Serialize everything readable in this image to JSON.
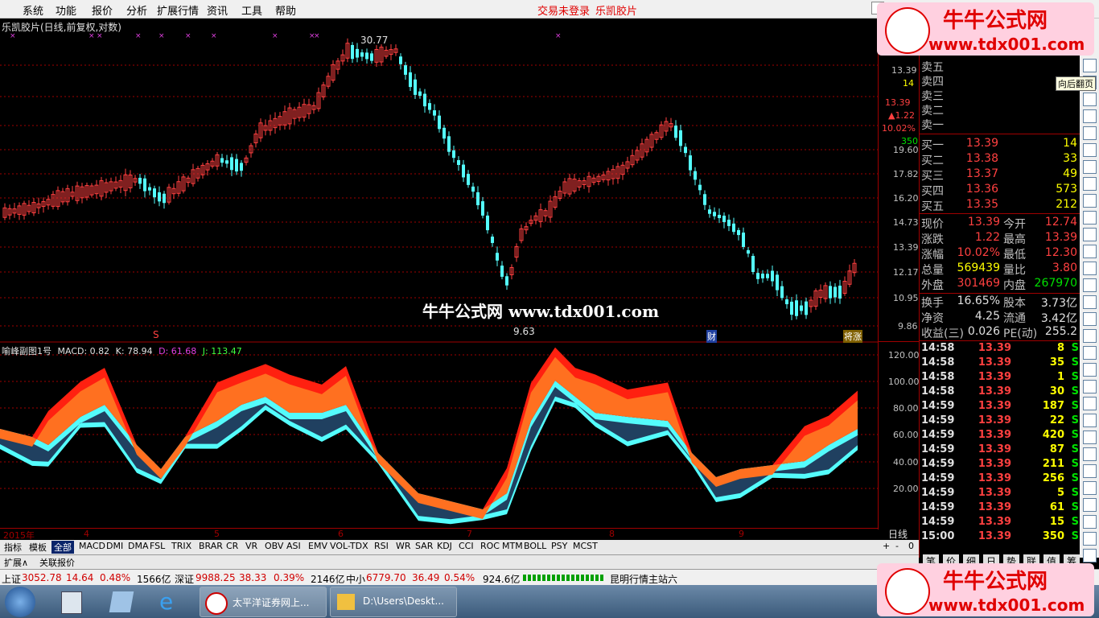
{
  "menu": {
    "items": [
      "系统",
      "功能",
      "报价",
      "分析",
      "扩展行情",
      "资讯",
      "工具",
      "帮助"
    ],
    "status": "交易未登录",
    "stock": "乐凯胶片"
  },
  "chart": {
    "title": "乐凯胶片(日线,前复权,对数)",
    "high_label": "30.77",
    "low_label": "9.63",
    "watermark": "牛牛公式网 www.tdx001.com",
    "marker_cai": "财",
    "marker_jiezhang": "将涨",
    "marker_s": "S",
    "price_ticks": [
      "13.39",
      "13.39",
      "12.17",
      "10.95",
      "9.86",
      "14.73",
      "16.20",
      "17.82",
      "19.60"
    ],
    "price_header": [
      "13.39",
      "14",
      "13.39",
      "▲1.22",
      "10.02%",
      "350"
    ],
    "indicator_title": "喻峰副图1号",
    "macd": "MACD: 0.82",
    "k": "K: 78.94",
    "d": "D: 61.68",
    "j": "J: 113.47",
    "ind_ticks": [
      "120.00",
      "100.00",
      "80.00",
      "60.00",
      "40.00",
      "20.00"
    ],
    "dates": [
      "2015年",
      "4",
      "5",
      "6",
      "7",
      "8",
      "9"
    ],
    "period": "日线"
  },
  "tabs": [
    "指标",
    "模板",
    "全部",
    "MACD",
    "DMI",
    "DMA",
    "FSL",
    "TRIX",
    "BRAR",
    "CR",
    "VR",
    "OBV",
    "ASI",
    "EMV",
    "VOL-TDX",
    "RSI",
    "WR",
    "SAR",
    "KDJ",
    "CCI",
    "ROC",
    "MTM",
    "BOLL",
    "PSY",
    "MCST"
  ],
  "tabs2": [
    "扩展∧",
    "关联报价"
  ],
  "tab_controls": [
    "+",
    "-",
    "0"
  ],
  "quote": {
    "sell": [
      "卖五",
      "卖四",
      "卖三",
      "卖二",
      "卖一"
    ],
    "buy": [
      {
        "label": "买一",
        "price": "13.39",
        "vol": "14"
      },
      {
        "label": "买二",
        "price": "13.38",
        "vol": "33"
      },
      {
        "label": "买三",
        "price": "13.37",
        "vol": "49"
      },
      {
        "label": "买四",
        "price": "13.36",
        "vol": "573"
      },
      {
        "label": "买五",
        "price": "13.35",
        "vol": "212"
      }
    ],
    "stats": [
      {
        "l1": "现价",
        "v1": "13.39",
        "l2": "今开",
        "v2": "12.74"
      },
      {
        "l1": "涨跌",
        "v1": "1.22",
        "l2": "最高",
        "v2": "13.39"
      },
      {
        "l1": "涨幅",
        "v1": "10.02%",
        "l2": "最低",
        "v2": "12.30"
      },
      {
        "l1": "总量",
        "v1": "569439",
        "l2": "量比",
        "v2": "3.80"
      },
      {
        "l1": "外盘",
        "v1": "301469",
        "l2": "内盘",
        "v2": "267970"
      }
    ],
    "stats2": [
      {
        "l1": "换手",
        "v1": "16.65%",
        "l2": "股本",
        "v2": "3.73亿"
      },
      {
        "l1": "净资",
        "v1": "4.25",
        "l2": "流通",
        "v2": "3.42亿"
      },
      {
        "l1": "收益(三)",
        "v1": "0.026",
        "l2": "PE(动)",
        "v2": "255.2"
      }
    ],
    "ticks": [
      {
        "t": "14:58",
        "p": "13.39",
        "v": "8",
        "s": "S"
      },
      {
        "t": "14:58",
        "p": "13.39",
        "v": "35",
        "s": "S"
      },
      {
        "t": "14:58",
        "p": "13.39",
        "v": "1",
        "s": "S"
      },
      {
        "t": "14:58",
        "p": "13.39",
        "v": "30",
        "s": "S"
      },
      {
        "t": "14:59",
        "p": "13.39",
        "v": "187",
        "s": "S"
      },
      {
        "t": "14:59",
        "p": "13.39",
        "v": "22",
        "s": "S"
      },
      {
        "t": "14:59",
        "p": "13.39",
        "v": "420",
        "s": "S"
      },
      {
        "t": "14:59",
        "p": "13.39",
        "v": "87",
        "s": "S"
      },
      {
        "t": "14:59",
        "p": "13.39",
        "v": "211",
        "s": "S"
      },
      {
        "t": "14:59",
        "p": "13.39",
        "v": "256",
        "s": "S"
      },
      {
        "t": "14:59",
        "p": "13.39",
        "v": "5",
        "s": "S"
      },
      {
        "t": "14:59",
        "p": "13.39",
        "v": "61",
        "s": "S"
      },
      {
        "t": "14:59",
        "p": "13.39",
        "v": "15",
        "s": "S"
      },
      {
        "t": "15:00",
        "p": "13.39",
        "v": "350",
        "s": "S"
      }
    ],
    "bottom_tabs": [
      "笔",
      "价",
      "细",
      "日",
      "势",
      "联",
      "值",
      "筹"
    ],
    "tooltip": "向后翻页"
  },
  "status": {
    "sh_label": "上证",
    "sh": "3052.78",
    "sh_chg": "14.64",
    "sh_pct": "0.48%",
    "sh_amt": "1566亿",
    "sz_label": "深证",
    "sz": "9988.25",
    "sz_chg": "38.33",
    "sz_pct": "0.39%",
    "sz_amt": "2146亿",
    "zx_label": "中小",
    "zx": "6779.70",
    "zx_chg": "36.49",
    "zx_pct": "0.54%",
    "zx_amt": "924.6亿",
    "server": "昆明行情主站六"
  },
  "taskbar": {
    "item1": "太平洋证券网上...",
    "item2": "D:\\Users\\Deskt..."
  },
  "brand": {
    "title": "牛牛公式网",
    "url": "www.tdx001.com"
  },
  "colors": {
    "up": "#ff4040",
    "down": "#54fcfc",
    "bg": "#000000",
    "grid": "#a00000"
  }
}
